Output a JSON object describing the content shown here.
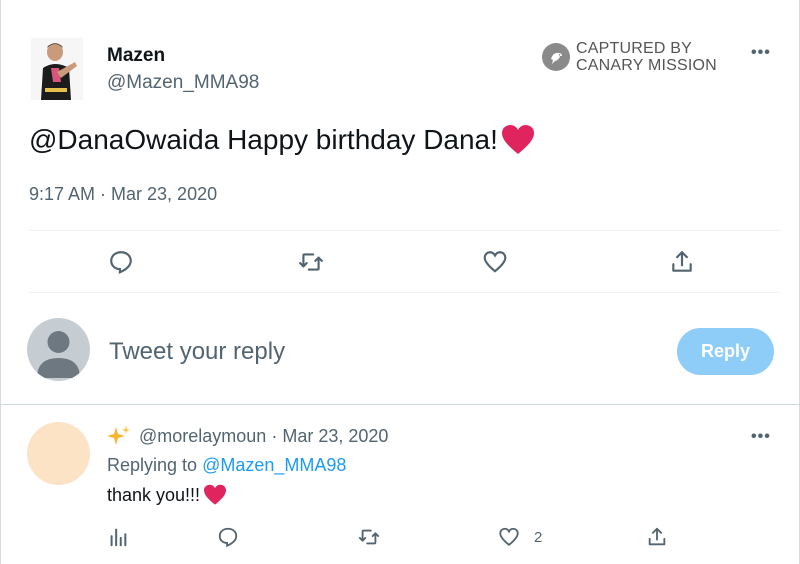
{
  "author": {
    "name": "Mazen",
    "handle": "@Mazen_MMA98"
  },
  "watermark": {
    "line1": "CAPTURED BY",
    "line2": "CANARY MISSION"
  },
  "more_label": "•••",
  "tweet": {
    "text": "@DanaOwaida Happy birthday Dana!",
    "emoji": "red-heart",
    "timestamp": "9:17 AM · Mar 23, 2020"
  },
  "composer": {
    "placeholder": "Tweet your reply",
    "reply_button": "Reply"
  },
  "reply": {
    "handle": "@morelaymoun",
    "separator": " · ",
    "date": "Mar 23, 2020",
    "replying_prefix": "Replying to ",
    "replying_handle": "@Mazen_MMA98",
    "text": "thank you!!!",
    "like_count": "2"
  },
  "icons": {
    "main_actions": [
      "reply-icon",
      "retweet-icon",
      "like-icon",
      "share-icon"
    ],
    "reply_actions": [
      "analytics-icon",
      "reply-icon",
      "retweet-icon",
      "like-icon",
      "share-icon"
    ]
  },
  "colors": {
    "accent": "#1d9bf0",
    "reply_button_disabled": "#8ecdf8",
    "heart": "#e0245e",
    "muted_text": "#536471"
  }
}
